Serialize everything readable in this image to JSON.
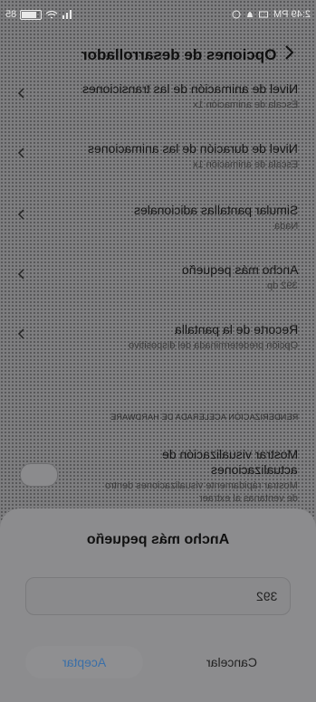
{
  "status": {
    "time": "2:49 PM",
    "battery": "85"
  },
  "header": {
    "title": "Opciones de desarrollador"
  },
  "settings": [
    {
      "title": "Nivel de animación de las transiciones",
      "subtitle": "Escala de animación 1x"
    },
    {
      "title": "Nivel de duración de las animaciones",
      "subtitle": "Escala de animación 1x"
    },
    {
      "title": "Simular pantallas adicionales",
      "subtitle": "Nada"
    },
    {
      "title": "Ancho más pequeño",
      "subtitle": "392 dp"
    },
    {
      "title": "Recorte de la pantalla",
      "subtitle": "Opción predeterminada del dispositivo"
    }
  ],
  "section": {
    "label": "RENDERIZACIÓN ACELERADA DE HARDWARE"
  },
  "toggle_row": {
    "title_line1": "Mostrar visualización de",
    "title_line2": "actualizaciones",
    "sub_line1": "Mostrar rápidamente visualizaciones dentro",
    "sub_line2": "de ventanas al extraer"
  },
  "dialog": {
    "title": "Ancho más pequeño",
    "value": "392",
    "cancel_label": "Cancelar",
    "accept_label": "Aceptar"
  }
}
